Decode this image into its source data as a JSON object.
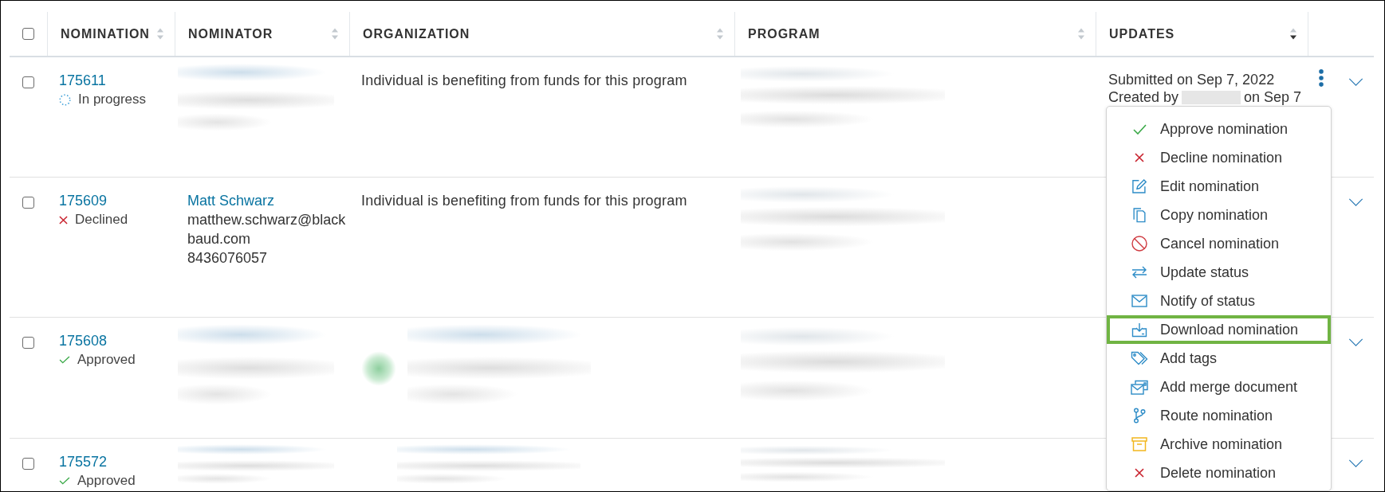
{
  "table": {
    "select_all": {
      "checked": false
    },
    "columns": [
      {
        "label": "NOMINATION",
        "sorted_descending": false
      },
      {
        "label": "NOMINATOR",
        "sorted_descending": false
      },
      {
        "label": "ORGANIZATION",
        "sorted_descending": false
      },
      {
        "label": "PROGRAM",
        "sorted_descending": false
      },
      {
        "label": "UPDATES",
        "sorted_descending": true
      }
    ],
    "rows": [
      {
        "checked": false,
        "number": "175611",
        "status": {
          "kind": "in_progress",
          "label": "In progress"
        },
        "nominator": {
          "blurred": true
        },
        "organization": {
          "blurred": false,
          "text": "Individual is benefiting from funds for this program"
        },
        "program": {
          "blurred": true
        },
        "updates": {
          "submitted": "Submitted on Sep 7, 2022",
          "created_prefix": "Created by",
          "creator_redacted": true,
          "created_suffix": "on Sep 7"
        },
        "more_button": true
      },
      {
        "checked": false,
        "number": "175609",
        "status": {
          "kind": "declined",
          "label": "Declined"
        },
        "nominator": {
          "blurred": false,
          "name": "Matt Schwarz",
          "email": "matthew.schwarz@blackbaud.com",
          "phone": "8436076057"
        },
        "organization": {
          "blurred": false,
          "text": "Individual is benefiting from funds for this program"
        },
        "program": {
          "blurred": true
        },
        "more_button": false
      },
      {
        "checked": false,
        "number": "175608",
        "status": {
          "kind": "approved",
          "label": "Approved"
        },
        "nominator": {
          "blurred": true
        },
        "organization": {
          "blurred": true,
          "logo": true
        },
        "program": {
          "blurred": true
        },
        "more_button": false
      },
      {
        "checked": false,
        "number": "175572",
        "status": {
          "kind": "approved",
          "label": "Approved"
        },
        "nominator": {
          "blurred": true
        },
        "organization": {
          "blurred": true,
          "logo": false
        },
        "program": {
          "blurred": true
        },
        "more_button": false
      }
    ]
  },
  "actions_menu": {
    "items": [
      {
        "label": "Approve nomination",
        "highlighted": false
      },
      {
        "label": "Decline nomination",
        "highlighted": false
      },
      {
        "label": "Edit nomination",
        "highlighted": false
      },
      {
        "label": "Copy nomination",
        "highlighted": false
      },
      {
        "label": "Cancel nomination",
        "highlighted": false
      },
      {
        "label": "Update status",
        "highlighted": false
      },
      {
        "label": "Notify of status",
        "highlighted": false
      },
      {
        "label": "Download nomination",
        "highlighted": true
      },
      {
        "label": "Add tags",
        "highlighted": false
      },
      {
        "label": "Add merge document",
        "highlighted": false
      },
      {
        "label": "Route nomination",
        "highlighted": false
      },
      {
        "label": "Archive nomination",
        "highlighted": false
      },
      {
        "label": "Delete nomination",
        "highlighted": false
      }
    ]
  }
}
